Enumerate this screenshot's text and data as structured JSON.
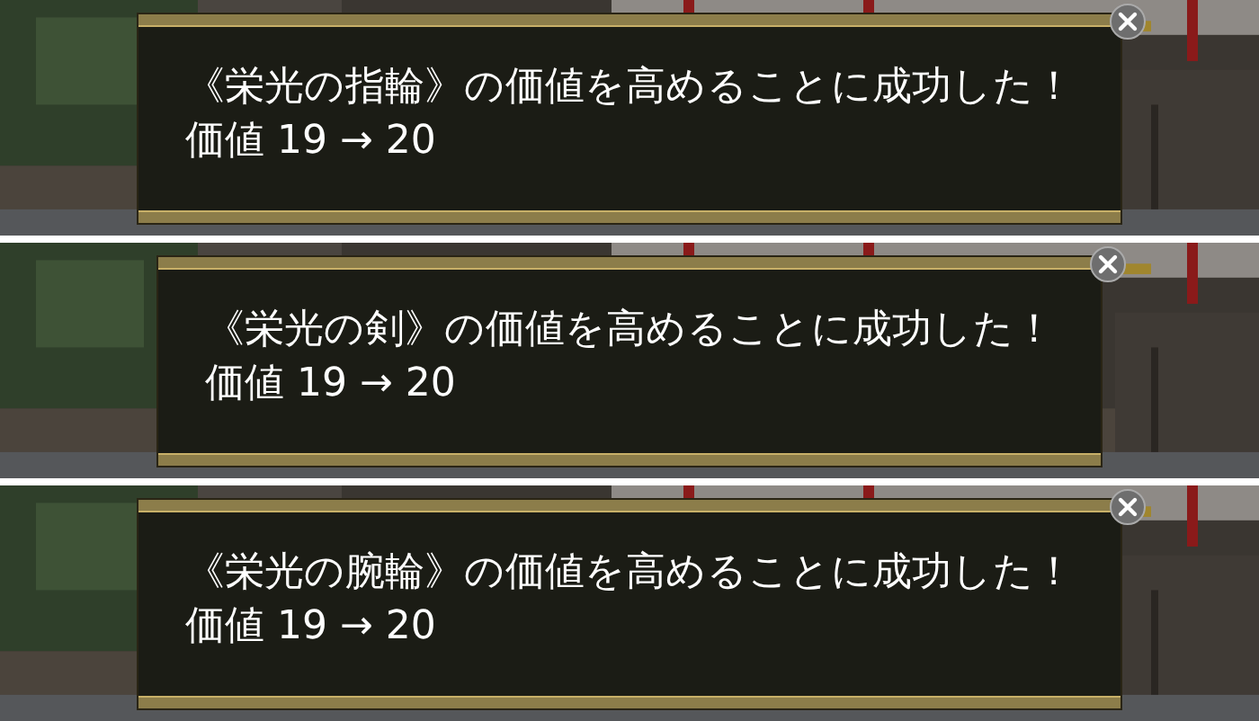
{
  "panels": [
    {
      "message": "《栄光の指輪》の価値を高めることに成功した！",
      "value_line": "価値 19 → 20"
    },
    {
      "message": "《栄光の剣》の価値を高めることに成功した！",
      "value_line": "価値 19 → 20"
    },
    {
      "message": "《栄光の腕輪》の価値を高めることに成功した！",
      "value_line": "価値 19 → 20"
    }
  ]
}
